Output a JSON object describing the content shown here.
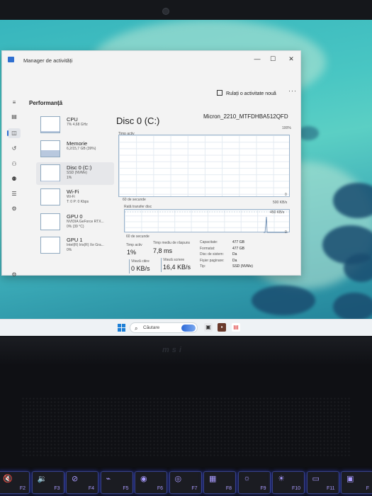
{
  "window": {
    "title": "Manager de activități",
    "minimize_glyph": "—",
    "maximize_glyph": "☐",
    "close_glyph": "✕"
  },
  "header": {
    "page_title": "Performanță",
    "run_task_label": "Rulați o activitate nouă",
    "more_glyph": "···"
  },
  "nav_icons": [
    "hamburger-icon",
    "processes-icon",
    "performance-icon",
    "history-icon",
    "startup-icon",
    "users-icon",
    "details-icon",
    "services-icon",
    "settings-icon"
  ],
  "sidebar": {
    "items": [
      {
        "name": "CPU",
        "sub1": "7% 4,68 GHz",
        "sub2": "",
        "fill": 0.07
      },
      {
        "name": "Memorie",
        "sub1": "6,2/15,7 GB (39%)",
        "sub2": "",
        "fill": 0.39
      },
      {
        "name": "Disc 0 (C:)",
        "sub1": "SSD (NVMe)",
        "sub2": "1%",
        "fill": 0.01
      },
      {
        "name": "Wi-Fi",
        "sub1": "Wi-Fi",
        "sub2": "T: 0 P: 0 Kbps",
        "fill": 0
      },
      {
        "name": "GPU 0",
        "sub1": "NVIDIA GeForce RTX...",
        "sub2": "0% (39 °C)",
        "fill": 0
      },
      {
        "name": "GPU 1",
        "sub1": "Intel(R) Iris(R) Xe Gra...",
        "sub2": "0%",
        "fill": 0
      }
    ]
  },
  "main": {
    "title": "Disc 0 (C:)",
    "model": "Micron_2210_MTFDHBA512QFD",
    "chart1": {
      "label": "Timp activ",
      "max_label": "100%",
      "time_label": "60 de secunde",
      "min_label": "0"
    },
    "chart2": {
      "label": "Rată transfer disc",
      "max_label": "500 KB/s",
      "ref_label": "450 KB/s",
      "time_label": "60 de secunde",
      "min_label": "0"
    },
    "stats": {
      "active_time_label": "Timp activ",
      "active_time_value": "1%",
      "avg_response_label": "Timp mediu de răspuns",
      "avg_response_value": "7,8 ms",
      "read_speed_label": "Viteză citire",
      "read_speed_value": "0 KB/s",
      "write_speed_label": "Viteză scriere",
      "write_speed_value": "16,4 KB/s"
    },
    "specs": [
      {
        "label": "Capacitate:",
        "value": "477 GB"
      },
      {
        "label": "Formatat:",
        "value": "477 GB"
      },
      {
        "label": "Disc de sistem:",
        "value": "Da"
      },
      {
        "label": "Fișier paginare:",
        "value": "Da"
      },
      {
        "label": "Tip:",
        "value": "SSD (NVMe)"
      }
    ]
  },
  "taskbar": {
    "search_placeholder": "Căutare",
    "search_glyph": "⌕"
  },
  "laptop": {
    "brand": "msi",
    "fkeys": [
      {
        "label": "F2",
        "glyph": "🔇"
      },
      {
        "label": "F3",
        "glyph": "🔉"
      },
      {
        "label": "F4",
        "glyph": "⊘"
      },
      {
        "label": "F5",
        "glyph": "⌁"
      },
      {
        "label": "F6",
        "glyph": "◉"
      },
      {
        "label": "F7",
        "glyph": "◎"
      },
      {
        "label": "F8",
        "glyph": "▦"
      },
      {
        "label": "F9",
        "glyph": "☼"
      },
      {
        "label": "F10",
        "glyph": "☀"
      },
      {
        "label": "F11",
        "glyph": "▭"
      },
      {
        "label": "F",
        "glyph": "▣"
      }
    ]
  },
  "colors": {
    "accent": "#2f6fd0",
    "chart_border": "#9bb4cc",
    "keyboard_glow": "#a99bff"
  }
}
